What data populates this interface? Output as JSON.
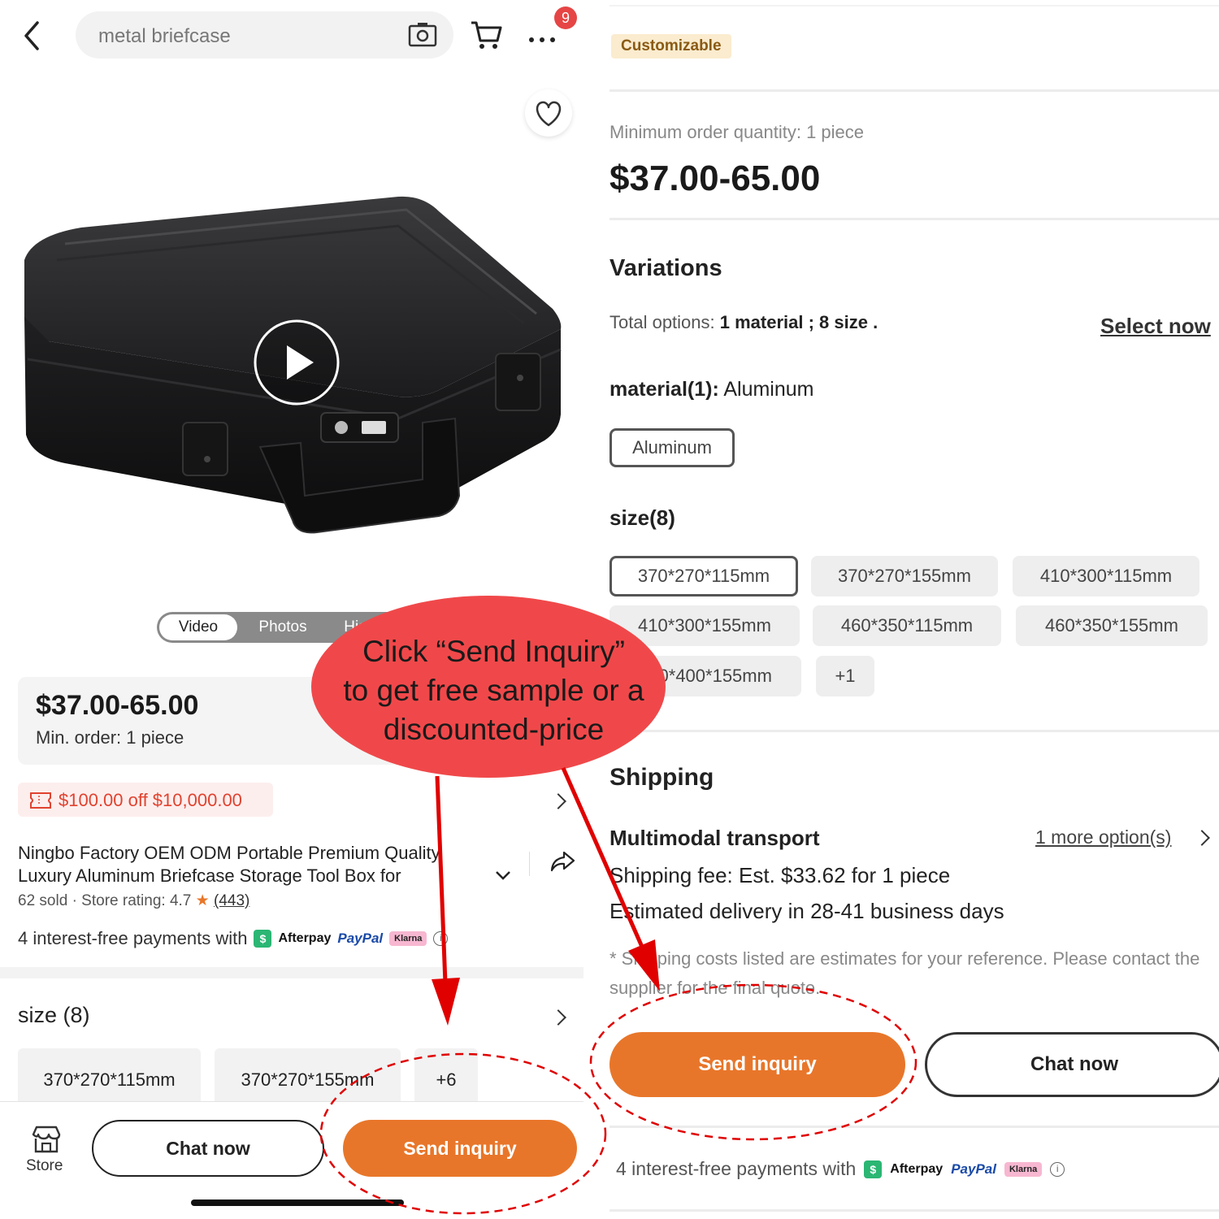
{
  "left": {
    "search": {
      "value": "metal briefcase"
    },
    "cart_badge": "9",
    "media_tabs": [
      "Video",
      "Photos",
      "Highlights"
    ],
    "price": "$37.00-65.00",
    "min_order": "Min. order: 1 piece",
    "coupon": "$100.00 off $10,000.00",
    "product_title": "Ningbo Factory OEM ODM Portable Premium Quality Luxury Aluminum Briefcase Storage Tool Box for",
    "sold": "62 sold",
    "store_rating_label": "Store rating: 4.7",
    "review_count": "(443)",
    "payments_text": "4 interest-free payments with",
    "payment_methods": [
      "Afterpay",
      "PayPal",
      "Klarna"
    ],
    "size_heading": "size (8)",
    "sizes": [
      "370*270*115mm",
      "370*270*155mm",
      "+6"
    ],
    "store_label": "Store",
    "chat_label": "Chat now",
    "send_label": "Send inquiry"
  },
  "right": {
    "badge": "Customizable",
    "moq": "Minimum order quantity: 1 piece",
    "price": "$37.00-65.00",
    "variations_title": "Variations",
    "total_prefix": "Total options:",
    "total_value": "1 material ; 8 size .",
    "select_now": "Select now",
    "material_label": "material(1):",
    "material_value": "Aluminum",
    "material_chip": "Aluminum",
    "size_label": "size(8)",
    "sizes": [
      "370*270*115mm",
      "370*270*155mm",
      "410*300*115mm",
      "410*300*155mm",
      "460*350*115mm",
      "460*350*155mm",
      "550*400*155mm",
      "+1"
    ],
    "shipping_title": "Shipping",
    "transport": "Multimodal transport",
    "more_options": "1 more option(s)",
    "fee": "Shipping fee: Est. $33.62 for 1 piece",
    "delivery": "Estimated delivery in 28-41 business days",
    "note": "* Shipping costs listed are estimates for your reference. Please contact the supplier for the final quote.",
    "send_label": "Send inquiry",
    "chat_label": "Chat now",
    "payments_text": "4 interest-free payments with",
    "payment_methods": [
      "Afterpay",
      "PayPal",
      "Klarna"
    ]
  },
  "callout": {
    "line1": "Click “Send Inquiry”",
    "line2": "to get free sample or a",
    "line3": "discounted-price",
    "bubble_color": "#f0484a",
    "arrow_color": "#e00000"
  },
  "colors": {
    "accent": "#e8762a",
    "coupon_text": "#e0432f"
  }
}
